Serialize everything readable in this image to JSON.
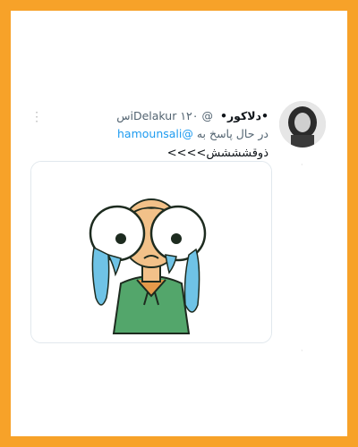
{
  "tweet": {
    "display_name": "•دلاکور•",
    "handle": "@iDelakur",
    "time": "۱۲۰س",
    "reply_prefix": "در حال پاسخ به",
    "reply_mention": "@hamounsali",
    "text": "ذوقشششش>>>>",
    "media_icon": "crying-cartoon-image"
  },
  "colors": {
    "frame": "#F7A229",
    "mention": "#1d9bf0"
  }
}
